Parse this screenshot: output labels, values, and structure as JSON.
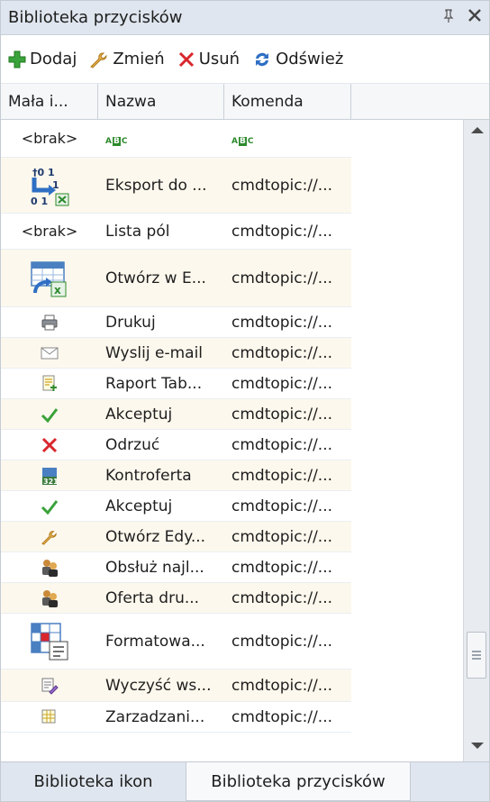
{
  "panel": {
    "title": "Biblioteka przycisków",
    "pin_glyph": "⫬",
    "close_glyph": "✕"
  },
  "toolbar": {
    "add_label": "Dodaj",
    "edit_label": "Zmień",
    "delete_label": "Usuń",
    "refresh_label": "Odśwież"
  },
  "columns": {
    "col1": "Mała i...",
    "col2": "Nazwa",
    "col3": "Komenda"
  },
  "rows": [
    {
      "icon_text": "<brak>",
      "name_abc": true,
      "command_abc": true,
      "icon": "none"
    },
    {
      "icon": "export-binary-icon",
      "name": "Eksport do ...",
      "command": "cmdtopic://..."
    },
    {
      "icon_text": "<brak>",
      "icon": "none",
      "name": "Lista pól",
      "command": "cmdtopic://..."
    },
    {
      "icon": "open-excel-icon",
      "name": "Otwórz w E...",
      "command": "cmdtopic://..."
    },
    {
      "icon": "printer-icon",
      "name": "Drukuj",
      "command": "cmdtopic://..."
    },
    {
      "icon": "envelope-icon",
      "name": "Wyslij e-mail",
      "command": "cmdtopic://..."
    },
    {
      "icon": "report-icon",
      "name": "Raport Tab...",
      "command": "cmdtopic://..."
    },
    {
      "icon": "checkmark-icon",
      "name": "Akceptuj",
      "command": "cmdtopic://..."
    },
    {
      "icon": "x-reject-icon",
      "name": "Odrzuć",
      "command": "cmdtopic://..."
    },
    {
      "icon": "counteroffer-icon",
      "name": "Kontroferta",
      "command": "cmdtopic://..."
    },
    {
      "icon": "checkmark-icon",
      "name": "Akceptuj",
      "command": "cmdtopic://..."
    },
    {
      "icon": "wrench-icon",
      "name": "Otwórz Edy...",
      "command": "cmdtopic://..."
    },
    {
      "icon": "users-icon",
      "name": "Obsłuż najl...",
      "command": "cmdtopic://..."
    },
    {
      "icon": "users-icon",
      "name": "Oferta dru...",
      "command": "cmdtopic://..."
    },
    {
      "icon": "format-table-icon",
      "name": "Formatowa...",
      "command": "cmdtopic://..."
    },
    {
      "icon": "clear-icon",
      "name": "Wyczyść ws...",
      "command": "cmdtopic://..."
    },
    {
      "icon": "manage-icon",
      "name": "Zarzadzani...",
      "command": "cmdtopic://..."
    }
  ],
  "tabs": {
    "tab1": "Biblioteka ikon",
    "tab2": "Biblioteka przycisków"
  },
  "colors": {
    "accent_green": "#2d8a2d",
    "reject_red": "#d9262c",
    "row_alt": "#fdf8ed",
    "titlebar": "#dfe6ef"
  }
}
